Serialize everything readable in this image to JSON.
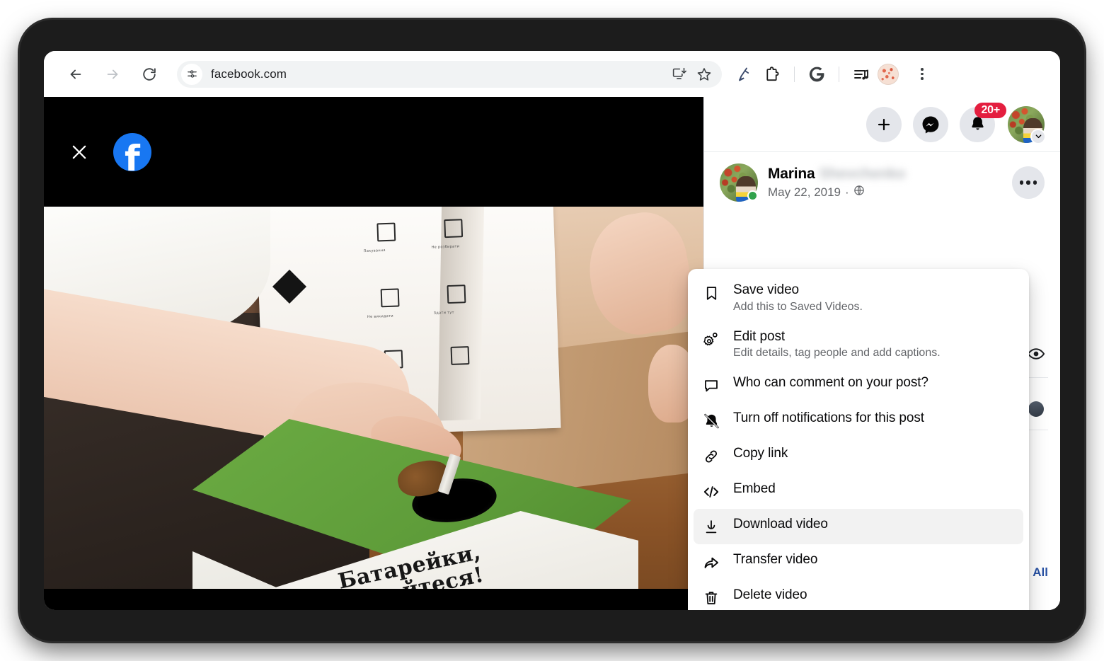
{
  "browser": {
    "back_label": "Back",
    "forward_label": "Forward",
    "reload_label": "Reload",
    "url": "facebook.com",
    "site_info_label": "View site information",
    "install_label": "Install",
    "bookmark_label": "Bookmark this tab",
    "extension1_label": "Extension",
    "extension2_label": "Extensions",
    "google_label": "Google",
    "media_label": "Media controls",
    "profile_label": "Profile",
    "menu_label": "Customize and control Chrome"
  },
  "theater": {
    "close_label": "Close",
    "logo_letter": "f",
    "video_caption_line1": "Батарейки,",
    "video_caption_line2": "йтеся!",
    "pictograms": [
      {
        "label": "Пакування"
      },
      {
        "label": "Не розбирати"
      },
      {
        "label": "Не викидати"
      },
      {
        "label": "Здати тут"
      }
    ]
  },
  "fb_topbar": {
    "create_label": "Create",
    "messenger_label": "Messenger",
    "notifications_label": "Notifications",
    "notification_count": "20+",
    "account_label": "Account"
  },
  "post": {
    "author_name": "Marina",
    "author_surname_blurred": "Shevchenko",
    "date": "May 22, 2019",
    "separator": "·",
    "audience_label": "Public",
    "more_options_label": "Actions for this post"
  },
  "sidebar": {
    "views_label": "Views",
    "all_link": "All"
  },
  "menu": {
    "items": [
      {
        "icon": "bookmark-icon",
        "title": "Save video",
        "subtitle": "Add this to Saved Videos.",
        "highlighted": false
      },
      {
        "icon": "gear-edit-icon",
        "title": "Edit post",
        "subtitle": "Edit details, tag people and add captions.",
        "highlighted": false
      },
      {
        "icon": "comment-bubble-icon",
        "title": "Who can comment on your post?",
        "subtitle": "",
        "highlighted": false
      },
      {
        "icon": "bell-slash-icon",
        "title": "Turn off notifications for this post",
        "subtitle": "",
        "highlighted": false
      },
      {
        "icon": "link-icon",
        "title": "Copy link",
        "subtitle": "",
        "highlighted": false
      },
      {
        "icon": "code-embed-icon",
        "title": "Embed",
        "subtitle": "",
        "highlighted": false
      },
      {
        "icon": "download-icon",
        "title": "Download video",
        "subtitle": "",
        "highlighted": true
      },
      {
        "icon": "share-arrow-icon",
        "title": "Transfer video",
        "subtitle": "",
        "highlighted": false
      },
      {
        "icon": "trash-icon",
        "title": "Delete video",
        "subtitle": "",
        "highlighted": false
      }
    ]
  },
  "colors": {
    "facebook_blue": "#1877f2",
    "notification_red": "#e41e3f",
    "online_green": "#31a24c",
    "link_blue": "#2851a3",
    "menu_highlight": "#f2f2f2"
  }
}
